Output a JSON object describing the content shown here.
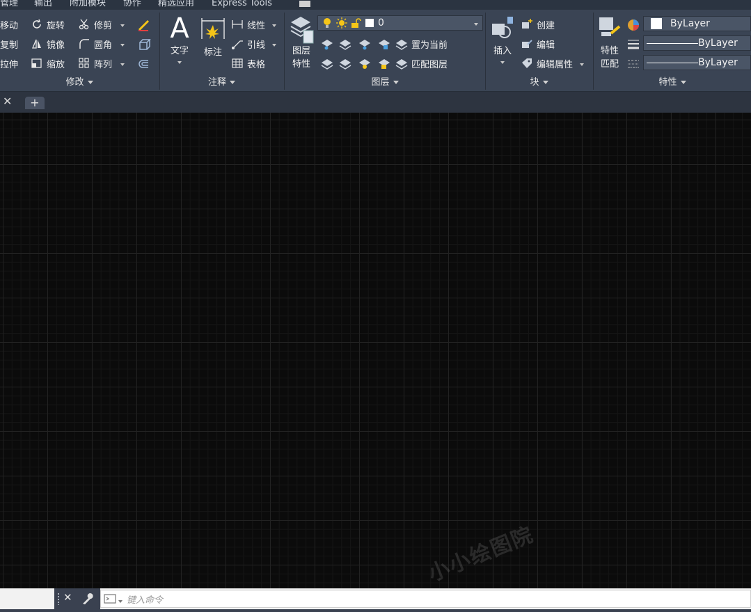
{
  "menu": [
    "管理",
    "输出",
    "附加模块",
    "协作",
    "精选应用",
    "Express Tools"
  ],
  "modify": {
    "move": "移动",
    "rotate": "旋转",
    "trim": "修剪",
    "copy": "复制",
    "mirror": "镜像",
    "fillet": "圆角",
    "stretch": "拉伸",
    "scale": "缩放",
    "array": "阵列",
    "title": "修改"
  },
  "annotate": {
    "text": "文字",
    "dim": "标注",
    "linear": "线性",
    "leader": "引线",
    "table": "表格",
    "title": "注释"
  },
  "layers": {
    "props_line1": "图层",
    "props_line2": "特性",
    "current": "0",
    "set_current": "置为当前",
    "match": "匹配图层",
    "title": "图层"
  },
  "block": {
    "insert": "插入",
    "create": "创建",
    "edit": "编辑",
    "edit_attr": "编辑属性",
    "title": "块"
  },
  "properties": {
    "match_line1": "特性",
    "match_line2": "匹配",
    "color": "ByLayer",
    "linetype": "ByLayer",
    "lineweight": "ByLayer",
    "title": "特性"
  },
  "command": {
    "placeholder": "键入命令"
  },
  "watermark": "小小绘图院",
  "colors": {
    "accent_yellow": "#f5c518",
    "ribbon_bg": "#3a4454"
  }
}
